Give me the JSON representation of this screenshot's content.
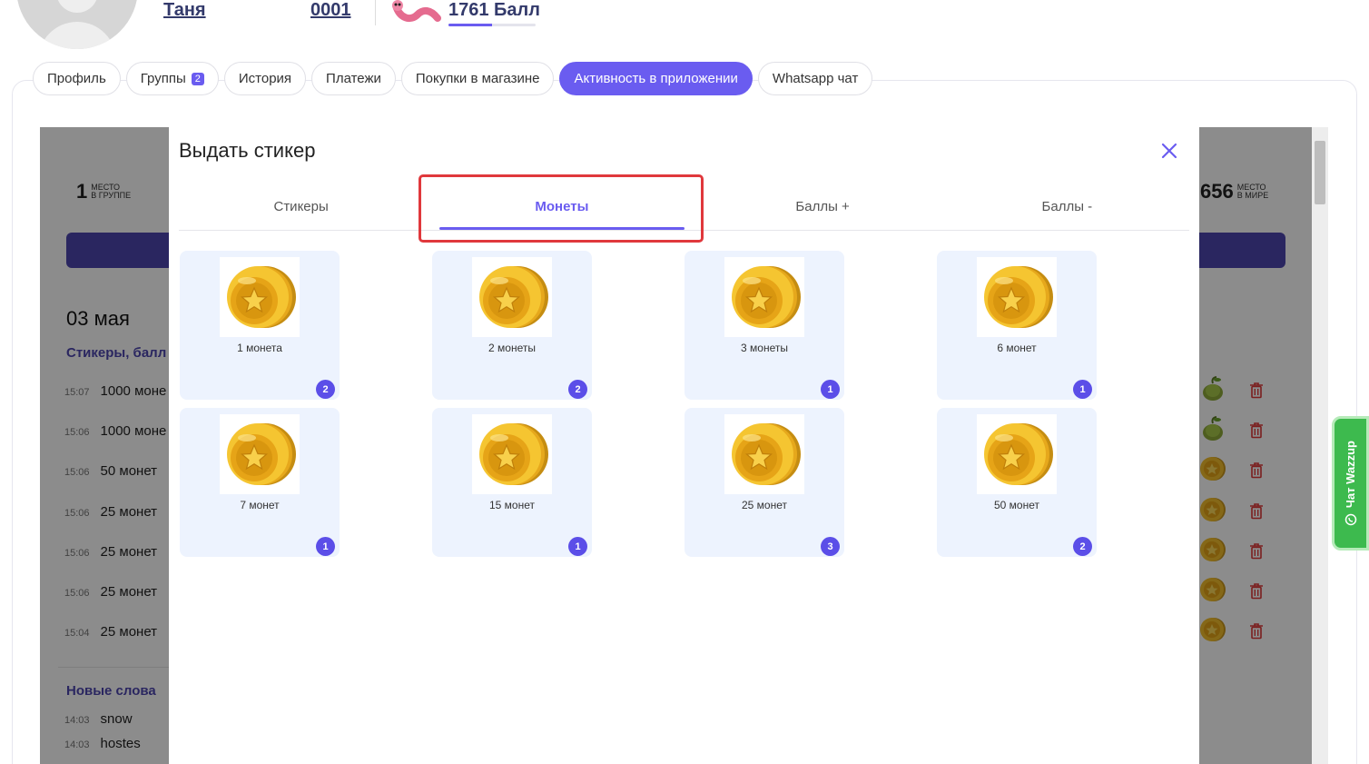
{
  "header": {
    "name": "Таня",
    "id": "0001",
    "points": "1761 Балл",
    "points_progress": 0.5
  },
  "tabs": [
    {
      "label": "Профиль"
    },
    {
      "label": "Группы",
      "badge": "2"
    },
    {
      "label": "История"
    },
    {
      "label": "Платежи"
    },
    {
      "label": "Покупки в магазине"
    },
    {
      "label": "Активность в приложении",
      "active": true
    },
    {
      "label": "Whatsapp чат"
    }
  ],
  "background": {
    "group_place": "1",
    "group_place_caption": [
      "МЕСТО",
      "В ГРУППЕ"
    ],
    "world_place": "656",
    "world_place_caption": [
      "МЕСТО",
      "В МИРЕ"
    ],
    "date": "03 мая",
    "section1": "Стикеры, балл",
    "rows": [
      {
        "time": "15:07",
        "text": "1000 моне",
        "icon": "plant-sticker-icon"
      },
      {
        "time": "15:06",
        "text": "1000 моне",
        "icon": "plant-sticker-icon"
      },
      {
        "time": "15:06",
        "text": "50 монет",
        "icon": "coin-icon"
      },
      {
        "time": "15:06",
        "text": "25 монет",
        "icon": "coin-icon"
      },
      {
        "time": "15:06",
        "text": "25 монет",
        "icon": "coin-icon"
      },
      {
        "time": "15:06",
        "text": "25 монет",
        "icon": "coin-icon"
      },
      {
        "time": "15:04",
        "text": "25 монет",
        "icon": "coin-icon"
      }
    ],
    "section2": "Новые слова",
    "words": [
      {
        "time": "14:03",
        "text": "snow"
      },
      {
        "time": "14:03",
        "text": "hostes"
      }
    ]
  },
  "modal": {
    "title": "Выдать стикер",
    "tabs": [
      {
        "label": "Стикеры"
      },
      {
        "label": "Монеты",
        "active": true
      },
      {
        "label": "Баллы +"
      },
      {
        "label": "Баллы -"
      }
    ],
    "cards": [
      {
        "label": "1 монета",
        "count": "2"
      },
      {
        "label": "2 монеты",
        "count": "2"
      },
      {
        "label": "3 монеты",
        "count": "1"
      },
      {
        "label": "6 монет",
        "count": "1"
      },
      {
        "label": "7 монет",
        "count": "1"
      },
      {
        "label": "15 монет",
        "count": "1"
      },
      {
        "label": "25 монет",
        "count": "3"
      },
      {
        "label": "50 монет",
        "count": "2"
      }
    ]
  },
  "whatsapp": {
    "label": "Чат Wazzup"
  },
  "colors": {
    "accent": "#6a5cf0",
    "highlight": "#e0383c",
    "whatsapp": "#3dba4e"
  }
}
